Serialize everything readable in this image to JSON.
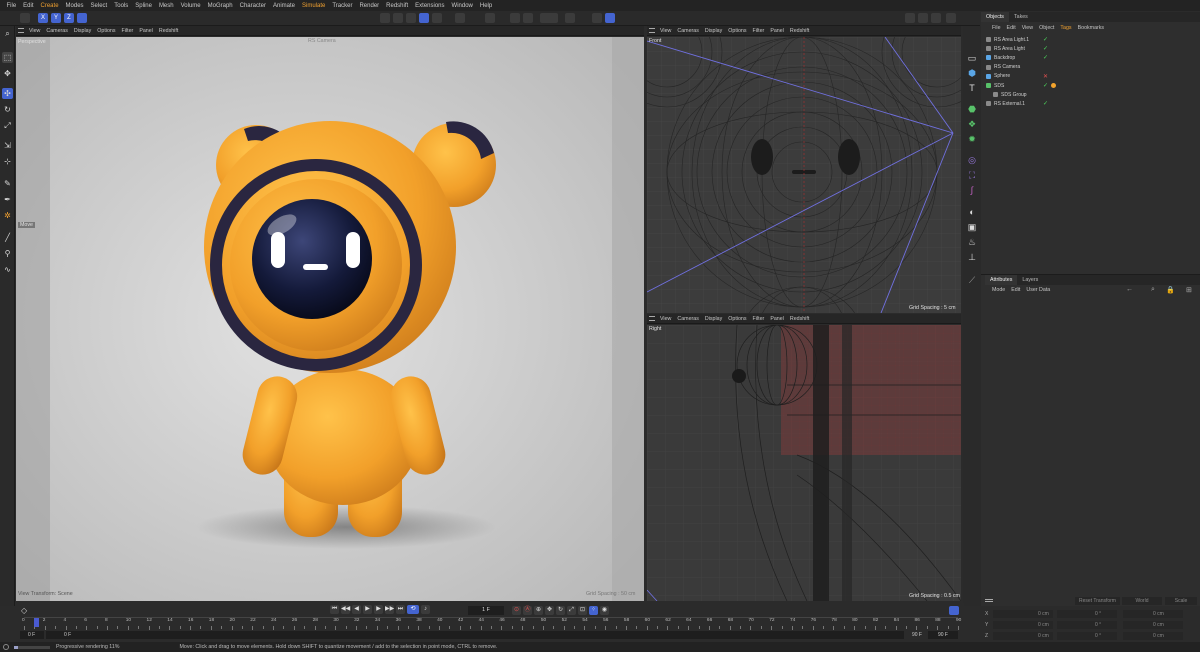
{
  "menu": [
    "File",
    "Edit",
    "Create",
    "Modes",
    "Select",
    "Tools",
    "Spline",
    "Mesh",
    "Volume",
    "MoGraph",
    "Character",
    "Animate",
    "Simulate",
    "Tracker",
    "Render",
    "Redshift",
    "Extensions",
    "Window",
    "Help"
  ],
  "toolbar": {
    "axis_x": "X",
    "axis_y": "Y",
    "axis_z": "Z"
  },
  "viewport_menu": [
    "View",
    "Cameras",
    "Display",
    "Options",
    "Filter",
    "Panel",
    "Redshift"
  ],
  "views": {
    "perspective": {
      "name": "Perspective",
      "hud_move": "Move",
      "hud_bottom_left": "View Transform: Scene",
      "hud_top_center": "RS Camera",
      "hud_grid": "Grid Spacing : 50 cm"
    },
    "front": {
      "name": "Front",
      "grid": "Grid Spacing : 5 cm"
    },
    "right": {
      "name": "Right",
      "grid": "Grid Spacing : 0.5 cm"
    }
  },
  "objects_panel": {
    "tabs": [
      "Objects",
      "Takes"
    ],
    "menu": [
      "File",
      "Edit",
      "View",
      "Object",
      "Tags",
      "Bookmarks"
    ],
    "items": [
      {
        "name": "RS Area Light.1",
        "color": "#8a8a8a",
        "state": "check"
      },
      {
        "name": "RS Area Light",
        "color": "#8a8a8a",
        "state": "check"
      },
      {
        "name": "Backdrop",
        "color": "#5aa6e6",
        "state": "check"
      },
      {
        "name": "RS Camera",
        "color": "#8a8a8a",
        "state": "none"
      },
      {
        "name": "Sphere",
        "color": "#5aa6e6",
        "state": "cross"
      },
      {
        "name": "SDS",
        "color": "#58c26a",
        "state": "check"
      },
      {
        "name": "SDS Group",
        "color": "#8a8a8a",
        "state": "none"
      },
      {
        "name": "RS External.1",
        "color": "#8a8a8a",
        "state": "check"
      }
    ]
  },
  "attributes_panel": {
    "tabs": [
      "Attributes",
      "Layers"
    ],
    "menu": [
      "Mode",
      "Edit",
      "User Data"
    ]
  },
  "coordinates": {
    "header": [
      "Reset Transform",
      "World",
      "Scale"
    ],
    "rows": [
      {
        "axis": "X",
        "pos": "0 cm",
        "rot": "0 °",
        "scale": "0 cm"
      },
      {
        "axis": "Y",
        "pos": "0 cm",
        "rot": "0 °",
        "scale": "0 cm"
      },
      {
        "axis": "Z",
        "pos": "0 cm",
        "rot": "0 °",
        "scale": "0 cm"
      }
    ]
  },
  "timeline": {
    "current_frame": "1 F",
    "start": "0 F",
    "start2": "0 F",
    "end": "90 F",
    "end2": "90 F",
    "ticks": [
      "0",
      "2",
      "4",
      "6",
      "8",
      "10",
      "12",
      "14",
      "16",
      "18",
      "20",
      "22",
      "24",
      "26",
      "28",
      "30",
      "32",
      "34",
      "36",
      "38",
      "40",
      "42",
      "44",
      "46",
      "48",
      "50",
      "52",
      "54",
      "56",
      "58",
      "60",
      "62",
      "64",
      "66",
      "68",
      "70",
      "72",
      "74",
      "76",
      "78",
      "80",
      "82",
      "84",
      "86",
      "88",
      "90"
    ]
  },
  "status": {
    "progress_label": "Progressive rendering 11%",
    "progress": 0.11,
    "hint": "Move: Click and drag to move elements. Hold down SHIFT to quantize movement / add to the selection in point mode, CTRL to remove."
  },
  "colors": {
    "accent": "#f0a030",
    "blue": "#4464d0",
    "check": "#4cd45a",
    "robot": "#f2a32c"
  }
}
